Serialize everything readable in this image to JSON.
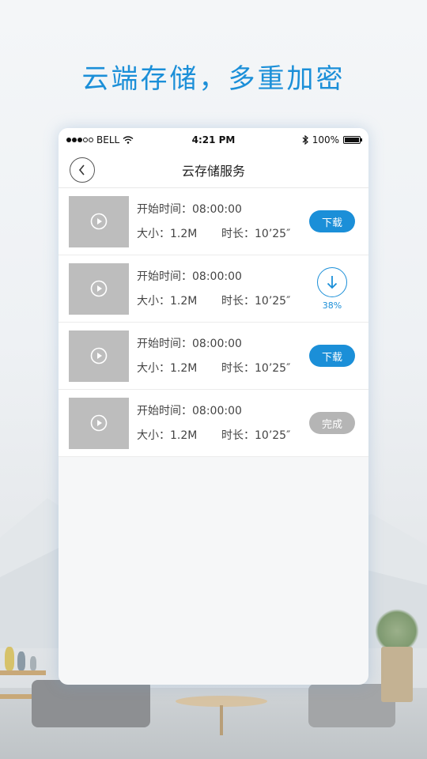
{
  "headline": "云端存储，多重加密",
  "status_bar": {
    "carrier": "BELL",
    "time": "4:21 PM",
    "battery": "100%"
  },
  "nav": {
    "title": "云存储服务"
  },
  "recordings": [
    {
      "start_label": "开始时间：",
      "start_time": "08:00:00",
      "size_label": "大小：",
      "size": "1.2M",
      "duration_label": "时长：",
      "duration": "10’25″",
      "action": "下载"
    },
    {
      "start_label": "开始时间：",
      "start_time": "08:00:00",
      "size_label": "大小：",
      "size": "1.2M",
      "duration_label": "时长：",
      "duration": "10’25″",
      "progress": "38%"
    },
    {
      "start_label": "开始时间：",
      "start_time": "08:00:00",
      "size_label": "大小：",
      "size": "1.2M",
      "duration_label": "时长：",
      "duration": "10’25″",
      "action": "下载"
    },
    {
      "start_label": "开始时间：",
      "start_time": "08:00:00",
      "size_label": "大小：",
      "size": "1.2M",
      "duration_label": "时长：",
      "duration": "10’25″",
      "action": "完成"
    }
  ],
  "colors": {
    "accent": "#1b8fd8",
    "done": "#b5b5b5",
    "thumbnail": "#bdbdbd"
  },
  "icons": {
    "back": "chevron-left-icon",
    "play": "play-icon",
    "download": "download-arrow-icon",
    "wifi": "wifi-icon",
    "bluetooth": "bluetooth-icon",
    "battery": "battery-icon"
  }
}
